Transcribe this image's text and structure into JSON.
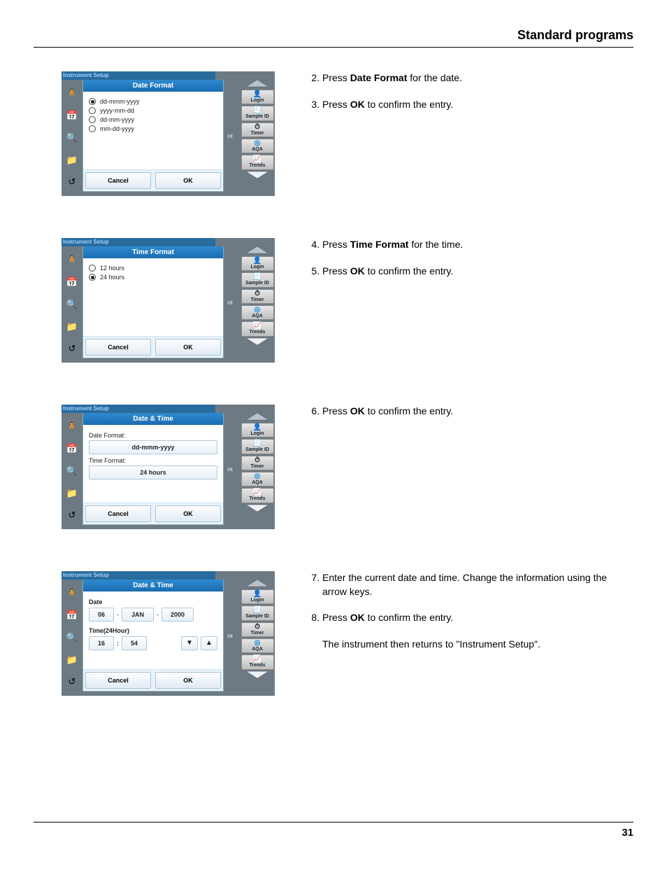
{
  "page": {
    "header": "Standard programs",
    "number": "31"
  },
  "sidebar_labels": {
    "login": "Login",
    "sample_id": "Sample ID",
    "timer": "Timer",
    "aqa": "AQA",
    "trends": "Trends"
  },
  "common": {
    "topbar": "Instrument Setup",
    "nt": "nt",
    "cancel": "Cancel",
    "ok": "OK"
  },
  "screen1": {
    "title": "Date Format",
    "options": [
      "dd-mmm-yyyy",
      "yyyy-mm-dd",
      "dd-mm-yyyy",
      "mm-dd-yyyy"
    ],
    "selected_index": 0
  },
  "screen2": {
    "title": "Time Format",
    "options": [
      "12 hours",
      "24 hours"
    ],
    "selected_index": 1
  },
  "screen3": {
    "title": "Date & Time",
    "date_format_label": "Date Format:",
    "date_format_value": "dd-mmm-yyyy",
    "time_format_label": "Time Format:",
    "time_format_value": "24 hours"
  },
  "screen4": {
    "title": "Date & Time",
    "date_label": "Date",
    "day": "06",
    "sep": "-",
    "month": "JAN",
    "year": "2000",
    "time_label": "Time(24Hour)",
    "hour": "16",
    "colon": ":",
    "minute": "54"
  },
  "steps": {
    "s2_a": "Press ",
    "s2_b": "Date Format",
    "s2_c": " for the date.",
    "s3_a": "Press ",
    "s3_b": "OK",
    "s3_c": " to confirm the entry.",
    "s4_a": "Press ",
    "s4_b": "Time Format",
    "s4_c": " for the time.",
    "s5_a": "Press ",
    "s5_b": "OK",
    "s5_c": " to confirm the entry.",
    "s6_a": "Press ",
    "s6_b": "OK",
    "s6_c": " to confirm the entry.",
    "s7": "Enter the current date and time. Change the information using the arrow keys.",
    "s8_a": "Press ",
    "s8_b": "OK",
    "s8_c": " to confirm the entry.",
    "s8_note": "The instrument then returns to \"Instrument Setup\"."
  }
}
